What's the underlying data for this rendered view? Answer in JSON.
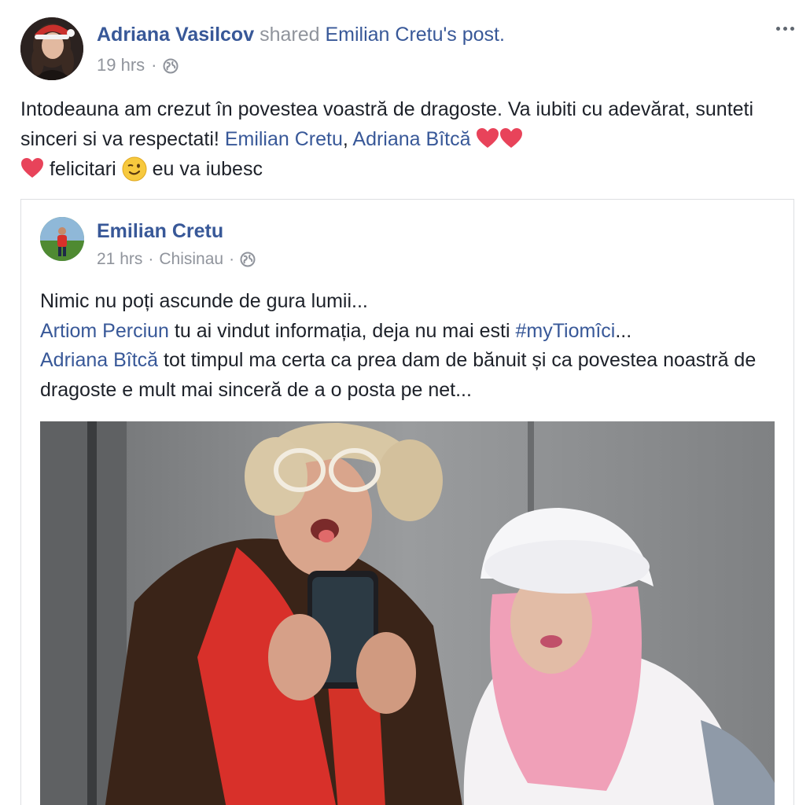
{
  "post": {
    "author": "Adriana Vasilcov",
    "action": "shared",
    "shared_ref": "Emilian Cretu's post.",
    "time": "19 hrs",
    "separator": "·",
    "privacy_icon": "globe-icon",
    "menu_icon": "more-horizontal-icon",
    "text": {
      "part1": "Intodeauna am crezut în povestea voastră de dragoste. Va iubiti cu adevărat, sunteti sinceri si va respectati! ",
      "tag1": "Emilian Cretu",
      "comma": ", ",
      "tag2": "Adriana Bîtcă",
      "part2": " felicitari ",
      "part3": " eu va iubesc"
    },
    "emojis": [
      "heart-emoji",
      "heart-emoji",
      "heart-emoji",
      "wink-emoji"
    ]
  },
  "shared": {
    "author": "Emilian Cretu",
    "time": "21 hrs",
    "location": "Chisinau",
    "separator": "·",
    "privacy_icon": "globe-icon",
    "text": {
      "line1": "Nimic nu poți ascunde de gura lumii...",
      "tag1": "Artiom Perciun",
      "line2": " tu ai vindut informația, deja nu mai esti ",
      "hashtag": "#myTiomîci",
      "ellipsis": "...",
      "tag2": "Adriana Bîtcă",
      "line3": " tot timpul ma certa ca prea dam de bănuit și ca povestea noastră de dragoste e mult mai sinceră de a o posta pe net..."
    },
    "photo": "elevator-selfie-photo"
  },
  "colors": {
    "link": "#385898",
    "muted": "#90949c",
    "text": "#1d2129",
    "heart": "#e8435a",
    "border": "#dddfe2"
  }
}
